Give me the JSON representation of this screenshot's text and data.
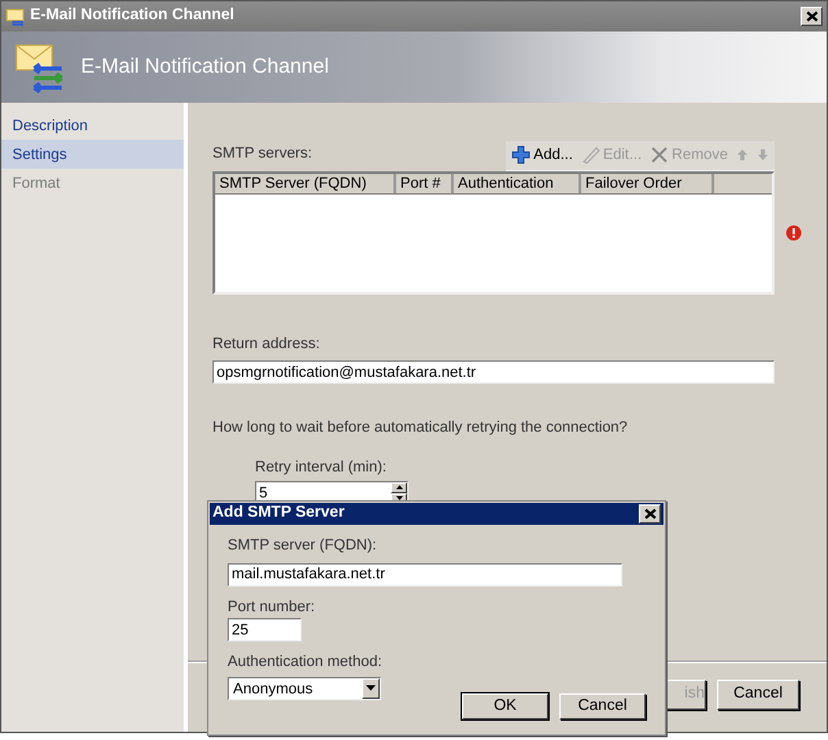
{
  "window": {
    "title": "E-Mail Notification Channel",
    "header": "E-Mail Notification Channel"
  },
  "sidebar": {
    "items": [
      {
        "label": "Description",
        "selected": false,
        "disabled": false
      },
      {
        "label": "Settings",
        "selected": true,
        "disabled": false
      },
      {
        "label": "Format",
        "selected": false,
        "disabled": true
      }
    ]
  },
  "smtp": {
    "label": "SMTP servers:",
    "toolbar": [
      {
        "kind": "add",
        "label": "Add...",
        "disabled": false
      },
      {
        "kind": "edit",
        "label": "Edit...",
        "disabled": true
      },
      {
        "kind": "remove",
        "label": "Remove",
        "disabled": true
      },
      {
        "kind": "up",
        "disabled": true
      },
      {
        "kind": "down",
        "disabled": true
      }
    ],
    "columns": [
      "SMTP Server (FQDN)",
      "Port #",
      "Authentication",
      "Failover Order"
    ],
    "error": true
  },
  "return_address": {
    "label": "Return address:",
    "value": "opsmgrnotification@mustafakara.net.tr"
  },
  "retry": {
    "question": "How long to wait before automatically retrying the connection?",
    "label": "Retry interval (min):",
    "value": "5"
  },
  "footer_buttons": [
    {
      "label": "ish",
      "disabled": true
    },
    {
      "label": "Cancel",
      "disabled": false
    }
  ],
  "dialog": {
    "title": "Add SMTP Server",
    "server_label": "SMTP server (FQDN):",
    "server_value": "mail.mustafakara.net.tr",
    "port_label": "Port number:",
    "port_value": "25",
    "auth_label": "Authentication method:",
    "auth_value": "Anonymous",
    "buttons": [
      {
        "label": "OK",
        "default": true
      },
      {
        "label": "Cancel",
        "default": false
      }
    ]
  }
}
